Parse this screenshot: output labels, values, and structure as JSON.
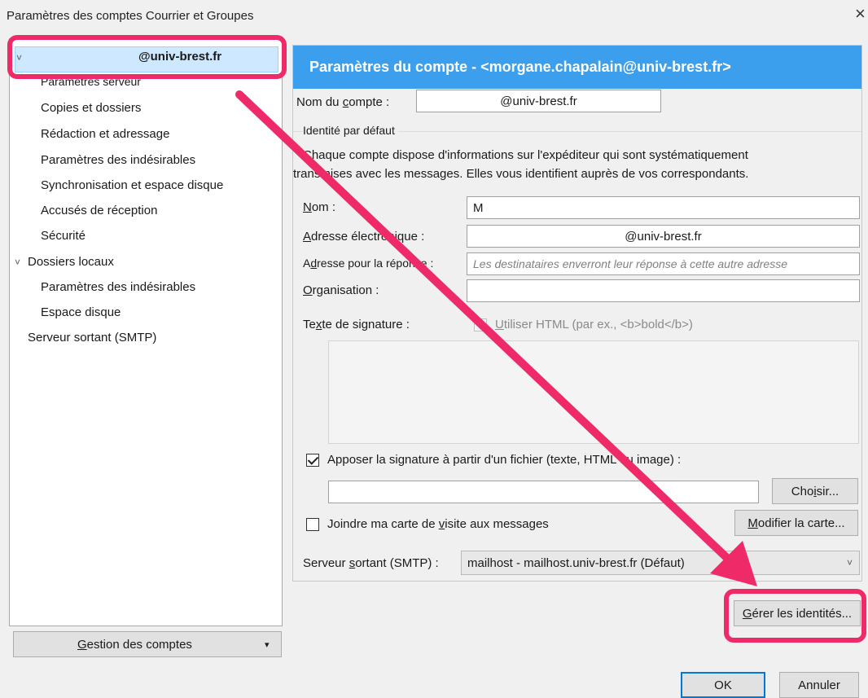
{
  "window": {
    "title": "Paramètres des comptes Courrier et Groupes",
    "close_label": "×"
  },
  "tree": {
    "account": "@univ-brest.fr",
    "account_children": [
      "Paramètres serveur",
      "Copies et dossiers",
      "Rédaction et adressage",
      "Paramètres des indésirables",
      "Synchronisation et espace disque",
      "Accusés de réception",
      "Sécurité"
    ],
    "local_folders": "Dossiers locaux",
    "local_children": [
      "Paramètres des indésirables",
      "Espace disque"
    ],
    "smtp": "Serveur sortant (SMTP)",
    "chevron": "˅"
  },
  "gestion": {
    "label_pre": "",
    "label_u": "G",
    "label_post": "estion des comptes",
    "dropdown": "▾"
  },
  "panel": {
    "header": "Paramètres du compte - <morgane.chapalain@univ-brest.fr>",
    "account_name": {
      "label_pre": "Nom du ",
      "label_u": "c",
      "label_post": "ompte :",
      "value": "@univ-brest.fr"
    },
    "identity": {
      "title": "Identité par défaut",
      "description_1": "Chaque compte dispose d'informations sur l'expéditeur qui sont systématiquement",
      "description_2": "transmises avec les messages. Elles vous identifient auprès de vos correspondants."
    },
    "name": {
      "label_u": "N",
      "label_post": "om :",
      "value": "M"
    },
    "email": {
      "label_u": "A",
      "label_post": "dresse électronique :",
      "value": "@univ-brest.fr"
    },
    "reply_to": {
      "label_pre": "A",
      "label_u": "d",
      "label_post": "resse pour la réponse :",
      "placeholder": "Les destinataires enverront leur réponse à cette autre adresse"
    },
    "organization": {
      "label_u": "O",
      "label_post": "rganisation :",
      "value": ""
    },
    "signature": {
      "label_pre": "Te",
      "label_u": "x",
      "label_post": "te de signature :",
      "html_u": "U",
      "html_post": "tiliser HTML (par ex., <b>bold</b>)",
      "html_checked": false,
      "text": ""
    },
    "sig_file": {
      "label": "Apposer la signature à partir d'un fichier (texte, HTML ou image) :",
      "checked": true,
      "value": ""
    },
    "choose": {
      "label_pre": "Cho",
      "label_u": "i",
      "label_post": "sir..."
    },
    "vcard": {
      "label_pre": "Joindre ma carte de ",
      "label_u": "v",
      "label_post": "isite aux messages",
      "checked": false
    },
    "edit_card": {
      "label_u": "M",
      "label_post": "odifier la carte..."
    },
    "smtp": {
      "label_pre": "Serveur ",
      "label_u": "s",
      "label_post": "ortant (SMTP) :",
      "value": "mailhost - mailhost.univ-brest.fr (Défaut)",
      "chevron": "˅"
    },
    "manage": {
      "label_u": "G",
      "label_post": "érer les identités..."
    }
  },
  "footer": {
    "ok": "OK",
    "cancel": "Annuler"
  },
  "colors": {
    "header_bg": "#3b9fee",
    "highlight": "#ee2b68",
    "selection": "#cde8ff"
  }
}
